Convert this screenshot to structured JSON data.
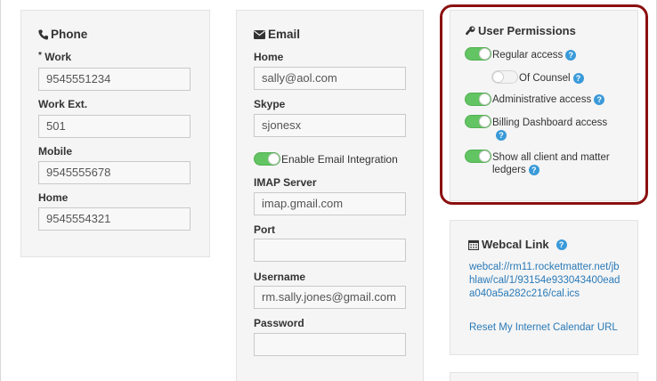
{
  "phone": {
    "title": "Phone",
    "icon": "phone-icon",
    "required_marker": "*",
    "fields": [
      {
        "label": "Work",
        "value": "9545551234"
      },
      {
        "label": "Work Ext.",
        "value": "501"
      },
      {
        "label": "Mobile",
        "value": "9545555678"
      },
      {
        "label": "Home",
        "value": "9545554321"
      }
    ]
  },
  "email": {
    "title": "Email",
    "icon": "envelope-icon",
    "home_label": "Home",
    "home_value": "sally@aol.com",
    "skype_label": "Skype",
    "skype_value": "sjonesx",
    "integration_label": "Enable Email Integration",
    "integration_enabled": true,
    "imap_label": "IMAP Server",
    "imap_value": "imap.gmail.com",
    "port_label": "Port",
    "port_value": "",
    "username_label": "Username",
    "username_value": "rm.sally.jones@gmail.com",
    "password_label": "Password",
    "password_value": ""
  },
  "permissions": {
    "title": "User Permissions",
    "icon": "wrench-icon",
    "items": [
      {
        "label": "Regular access",
        "enabled": true
      },
      {
        "label": "Of Counsel",
        "enabled": false
      },
      {
        "label": "Administrative access",
        "enabled": true
      },
      {
        "label": "Billing Dashboard access",
        "enabled": true
      },
      {
        "label": "Show all client and matter ledgers",
        "enabled": true
      }
    ],
    "help_glyph": "?"
  },
  "webcal": {
    "title": "Webcal Link",
    "icon": "calendar-icon",
    "help_glyph": "?",
    "url": "webcal://rm11.rocketmatter.net/jbhlaw/cal/1/93154e933043400eada040a5a282c216/cal.ics",
    "reset_label": "Reset My Internet Calendar URL"
  },
  "colors": {
    "toggle_on": "#62c462",
    "link": "#2a7ab8",
    "help": "#3a9ad9",
    "highlight": "#8b1010"
  }
}
